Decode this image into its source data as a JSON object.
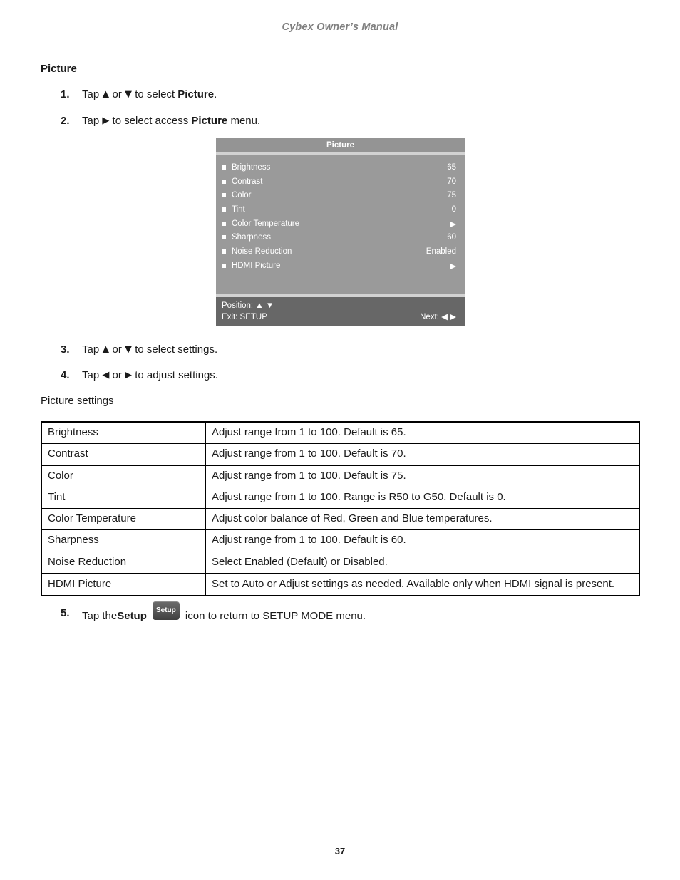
{
  "header": {
    "title": "Cybex Owner’s Manual"
  },
  "section": {
    "title": "Picture"
  },
  "steps": [
    {
      "num": "1.",
      "pre": "Tap ",
      "g1": "▲",
      "mid": " or ",
      "g2": "▼",
      "post": " to select ",
      "bold": "Picture",
      "tail": "."
    },
    {
      "num": "2.",
      "pre": "Tap ",
      "g1": "▶",
      "mid": "",
      "g2": "",
      "post": " to select access ",
      "bold": "Picture",
      "tail": " menu."
    },
    {
      "num": "3.",
      "pre": "Tap ",
      "g1": "▲",
      "mid": " or ",
      "g2": "▼",
      "post": " to select settings.",
      "bold": "",
      "tail": ""
    },
    {
      "num": "4.",
      "pre": "Tap ",
      "g1": "◀",
      "mid": " or ",
      "g2": "▶",
      "post": " to adjust settings.",
      "bold": "",
      "tail": ""
    },
    {
      "num": "5.",
      "pre": "Tap the ",
      "bold": "Setup",
      "icon_label": "Setup",
      "post": " icon to return to SETUP MODE menu."
    }
  ],
  "osd": {
    "title": "Picture",
    "rows": [
      {
        "label": "Brightness",
        "value": "65"
      },
      {
        "label": "Contrast",
        "value": "70"
      },
      {
        "label": "Color",
        "value": "75"
      },
      {
        "label": "Tint",
        "value": "0"
      },
      {
        "label": "Color Temperature",
        "value": "▶"
      },
      {
        "label": "Sharpness",
        "value": "60"
      },
      {
        "label": "Noise Reduction",
        "value": "Enabled"
      },
      {
        "label": "HDMI Picture",
        "value": "▶"
      }
    ],
    "footer": {
      "position_label": "Position: ▲ ▼",
      "exit_label": "Exit: SETUP",
      "next_label": "Next: ◀ ▶"
    },
    "colors": {
      "title_bar": "#949494",
      "body": "#9a9a9a",
      "footer": "#676767",
      "rule": "#d2d2d2",
      "text": "#ffffff"
    }
  },
  "caption": {
    "text": "Picture settings"
  },
  "table": {
    "rows": [
      {
        "setting": "Brightness",
        "description": "Adjust range from 1 to 100. Default is 65."
      },
      {
        "setting": "Contrast",
        "description": "Adjust range from 1 to 100. Default is 70."
      },
      {
        "setting": "Color",
        "description": "Adjust range from 1 to 100. Default is 75."
      },
      {
        "setting": "Tint",
        "description": "Adjust range from 1 to 100. Range is R50 to G50. Default is 0."
      },
      {
        "setting": "Color Temperature",
        "description": "Adjust color balance of Red, Green and Blue temperatures."
      },
      {
        "setting": "Sharpness",
        "description": "Adjust range from 1 to 100. Default is 60."
      },
      {
        "setting": "Noise Reduction",
        "description": "Select Enabled (Default) or Disabled."
      },
      {
        "setting": "HDMI Picture",
        "description": "Set to Auto or Adjust settings as needed. Available only when HDMI signal is present."
      }
    ]
  },
  "footer": {
    "page_number": "37"
  }
}
